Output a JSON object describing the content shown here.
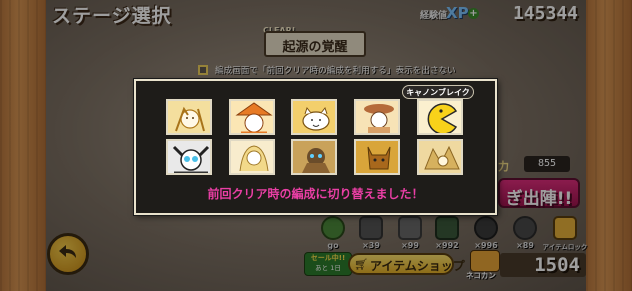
{
  "header": {
    "title": "ステージ選択",
    "xp_label": "経験値",
    "xp_icon": "XP",
    "xp_plus": "+",
    "xp_value": "145344"
  },
  "stage": {
    "clear_label": "CLEAR!",
    "name": "起源の覚醒"
  },
  "option": {
    "checked": false,
    "text": "編成画面で「前回クリア時の編成を利用する」表示を出さない"
  },
  "battle": {
    "power_label": "力",
    "power_value": "855",
    "attack_label": "ぎ出陣!!"
  },
  "items": [
    {
      "icon": "green-item-icon",
      "count": "go"
    },
    {
      "icon": "rich-cat-icon",
      "count": "×39"
    },
    {
      "icon": "cpu-icon",
      "count": "×99"
    },
    {
      "icon": "treasure-radar-icon",
      "count": "×992"
    },
    {
      "icon": "sniper-cat-icon",
      "count": "×996"
    },
    {
      "icon": "cat-jobs-icon",
      "count": "×89"
    },
    {
      "icon": "item-lock-icon",
      "count": "アイテムロック"
    }
  ],
  "footer": {
    "sale_text": "セール中!!",
    "sale_sub": "あと 1日",
    "shop_label": "アイテムショップ",
    "catfood_label": "ネコカン",
    "catfood_value": "1504"
  },
  "popup": {
    "cannon_label": "キャノンブレイク砲",
    "message": "前回クリア時の編成に切り替えました！",
    "row1": [
      "cat-unit-1",
      "cat-unit-2",
      "cat-unit-3",
      "cat-unit-4",
      "cat-unit-5"
    ],
    "row2": [
      "cat-unit-6",
      "cat-unit-7",
      "cat-unit-8",
      "cat-unit-9",
      "cat-unit-10"
    ]
  },
  "colors": {
    "popup_message": "#ea3fa5",
    "attack_button": "#d32577",
    "slot_gold": "#f7e9b8",
    "xp_blue": "#7ec6ff"
  }
}
